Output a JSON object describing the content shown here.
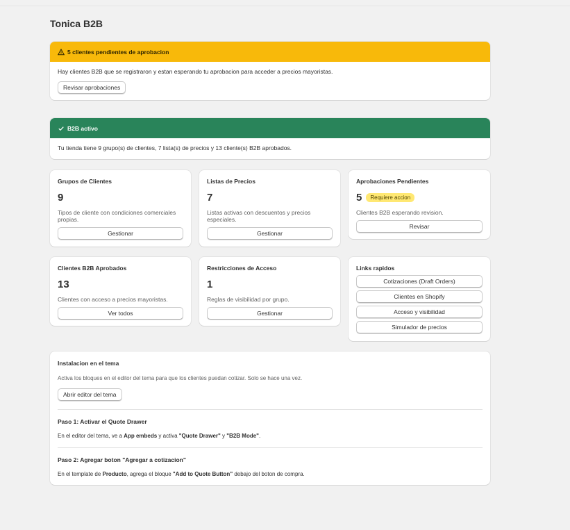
{
  "page": {
    "title": "Tonica B2B"
  },
  "warning_banner": {
    "title": "5 clientes pendientes de aprobacion",
    "message": "Hay clientes B2B que se registraron y estan esperando tu aprobacion para acceder a precios mayoristas.",
    "button": "Revisar aprobaciones"
  },
  "status_banner": {
    "title": "B2B activo",
    "message": "Tu tienda tiene 9 grupo(s) de clientes, 7 lista(s) de precios y 13 cliente(s) B2B aprobados."
  },
  "cards": {
    "groups": {
      "title": "Grupos de Clientes",
      "value": "9",
      "desc": "Tipos de cliente con condiciones comerciales propias.",
      "button": "Gestionar"
    },
    "price_lists": {
      "title": "Listas de Precios",
      "value": "7",
      "desc": "Listas activas con descuentos y precios especiales.",
      "button": "Gestionar"
    },
    "pending": {
      "title": "Aprobaciones Pendientes",
      "value": "5",
      "badge": "Requiere accion",
      "desc": "Clientes B2B esperando revision.",
      "button": "Revisar"
    },
    "approved": {
      "title": "Clientes B2B Aprobados",
      "value": "13",
      "desc": "Clientes con acceso a precios mayoristas.",
      "button": "Ver todos"
    },
    "restrictions": {
      "title": "Restricciones de Acceso",
      "value": "1",
      "desc": "Reglas de visibilidad por grupo.",
      "button": "Gestionar"
    }
  },
  "quick_links": {
    "title": "Links rapidos",
    "items": [
      "Cotizaciones (Draft Orders)",
      "Clientes en Shopify",
      "Acceso y visibilidad",
      "Simulador de precios"
    ]
  },
  "install": {
    "title": "Instalacion en el tema",
    "desc": "Activa los bloques en el editor del tema para que los clientes puedan cotizar. Solo se hace una vez.",
    "button": "Abrir editor del tema",
    "step1": {
      "title": "Paso 1: Activar el Quote Drawer",
      "t1": "En el editor del tema, ve a ",
      "b1": "App embeds",
      "t2": " y activa ",
      "b2": "\"Quote Drawer\"",
      "t3": " y ",
      "b3": "\"B2B Mode\"",
      "t4": "."
    },
    "step2": {
      "title": "Paso 2: Agregar boton \"Agregar a cotizacion\"",
      "t1": "En el template de ",
      "b1": "Producto",
      "t2": ", agrega el bloque ",
      "b2": "\"Add to Quote Button\"",
      "t3": " debajo del boton de compra."
    }
  },
  "colors": {
    "warning": "#f8b90a",
    "success": "#29845a",
    "badge": "#ffe873"
  }
}
